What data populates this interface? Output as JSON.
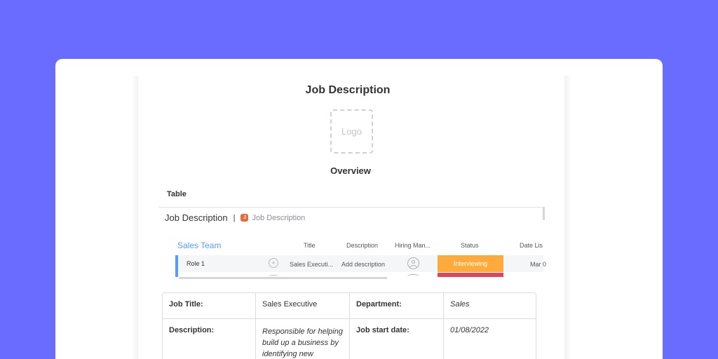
{
  "doc": {
    "title": "Job Description",
    "logo_placeholder": "Logo",
    "overview_heading": "Overview",
    "table_label": "Table"
  },
  "board": {
    "title": "Job Description",
    "separator": "|",
    "badge_letter": "J",
    "subtitle": "Job Description",
    "group_name": "Sales Team",
    "columns": [
      "Title",
      "Description",
      "Hiring Man...",
      "Status",
      "Date Lis"
    ],
    "rows": [
      {
        "name": "Role 1",
        "title": "Sales Executi...",
        "description": "Add description",
        "status": "Interviewing",
        "date": "Mar 0"
      }
    ],
    "colors": {
      "group": "#579bfc",
      "status_interviewing": "#fdab3d",
      "status_next": "#e2445c",
      "badge": "#e8693b"
    },
    "icons": [
      "chat-bubble-plus-icon",
      "person-avatar-icon"
    ]
  },
  "info_table": {
    "job_title_label": "Job Title:",
    "job_title_value": "Sales Executive",
    "department_label": "Department:",
    "department_value": "Sales",
    "description_label": "Description:",
    "description_value": "Responsible for helping build up a business by identifying new",
    "start_date_label": "Job start date:",
    "start_date_value": "01/08/2022"
  },
  "colors": {
    "background": "#6a6cff",
    "card": "#ffffff"
  }
}
